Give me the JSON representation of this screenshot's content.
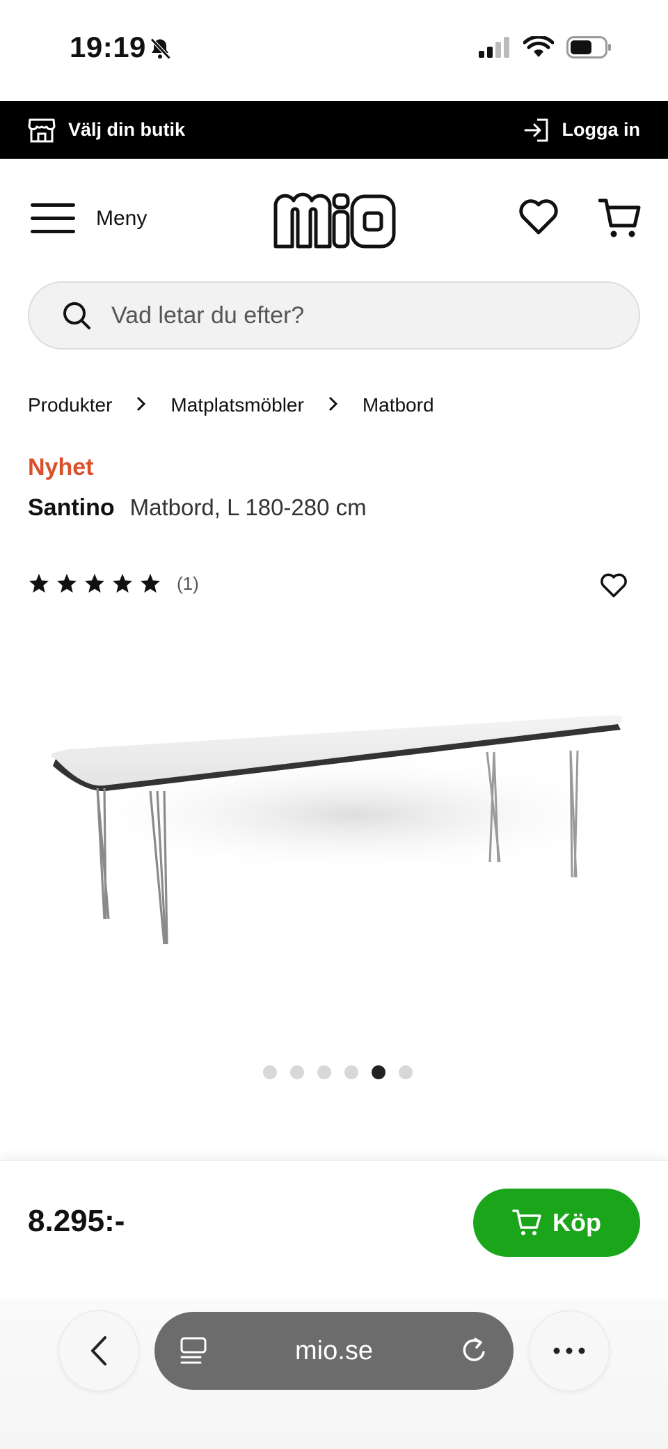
{
  "status_bar": {
    "time": "19:19",
    "icons": [
      "bell-slash-icon",
      "cellular-signal-icon",
      "wifi-icon",
      "battery-icon"
    ]
  },
  "top_bar": {
    "store_label": "Välj din butik",
    "store_icon": "store-icon",
    "login_label": "Logga in",
    "login_icon": "login-icon"
  },
  "header": {
    "menu_label": "Meny",
    "menu_icon": "hamburger-icon",
    "logo_text": "mio",
    "icons": [
      "heart-icon",
      "cart-icon"
    ]
  },
  "search": {
    "placeholder": "Vad letar du efter?",
    "icon": "search-icon"
  },
  "breadcrumb": {
    "items": [
      "Produkter",
      "Matplatsmöbler",
      "Matbord"
    ]
  },
  "product": {
    "badge": "Nyhet",
    "name": "Santino",
    "description": "Matbord, L 180-280 cm",
    "rating_stars": 5,
    "rating_count": "(1)",
    "image_count": 6,
    "active_image_index": 4,
    "price": "8.295:-",
    "buy_label": "Köp"
  },
  "browser": {
    "url": "mio.se",
    "icons": [
      "back-icon",
      "tabs-icon",
      "reload-icon",
      "more-icon"
    ]
  },
  "colors": {
    "badge": "#d9502b",
    "buy_button": "#1aa51a",
    "top_bar": "#000000",
    "url_bar": "#6c6c6c"
  }
}
